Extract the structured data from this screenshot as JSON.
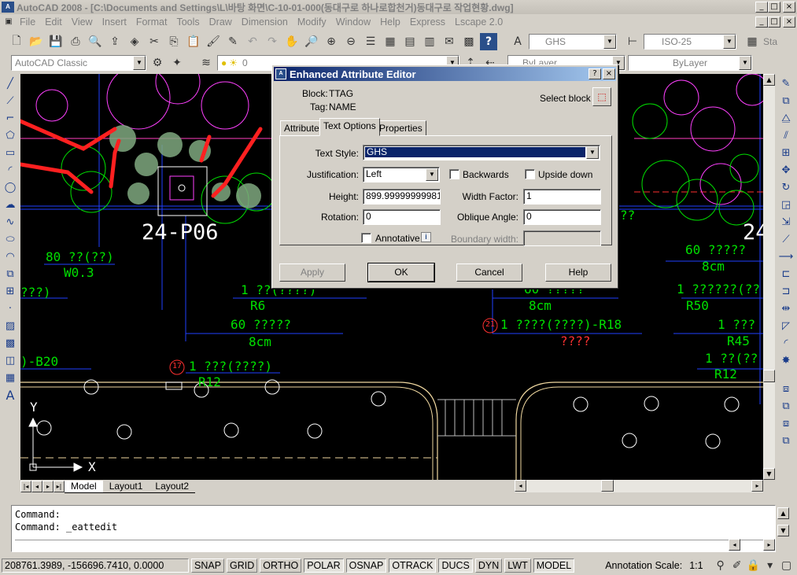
{
  "window": {
    "title": "AutoCAD 2008 - [C:\\Documents and Settings\\L\\바탕 화면\\C-10-01-000(동대구로 하나로합천거)동대구로 작업현황.dwg]",
    "icon": "autocad-app-icon",
    "min": "_",
    "restore": "□",
    "close": "×"
  },
  "menu": [
    "File",
    "Edit",
    "View",
    "Insert",
    "Format",
    "Tools",
    "Draw",
    "Dimension",
    "Modify",
    "Window",
    "Help",
    "Express",
    "Lscape 2.0"
  ],
  "toolbar": {
    "text_style_combo": "GHS",
    "dim_style_combo": "ISO-25",
    "workspace_combo": "AutoCAD Classic",
    "layer_combo": "0",
    "color_combo": "ByLayer",
    "linetype_combo": "ByLayer",
    "sta_label": "Sta"
  },
  "drawing": {
    "labels": [
      {
        "text": "24-P06",
        "color": "#ffffff"
      },
      {
        "text": "80 ??(??)",
        "color": "#00e000"
      },
      {
        "text": "W0.3",
        "color": "#00e000"
      },
      {
        "text": "???)",
        "color": "#00e000"
      },
      {
        "text": "1 ??(????)",
        "color": "#00e000"
      },
      {
        "text": "R6",
        "color": "#00e000"
      },
      {
        "text": "60 ?????",
        "color": "#00e000"
      },
      {
        "text": "8cm",
        "color": "#00e000"
      },
      {
        "text": ")-B20",
        "color": "#00e000"
      },
      {
        "text": "1 ???(????)",
        "color": "#00e000"
      },
      {
        "text": "R12",
        "color": "#00e000"
      },
      {
        "text": "1 ????(????)-R18",
        "color": "#00e000"
      },
      {
        "text": "????",
        "color": "#ff3030"
      },
      {
        "text": "60 ?????",
        "color": "#00e000"
      },
      {
        "text": "8cm",
        "color": "#00e000"
      },
      {
        "text": "1 ??????(??",
        "color": "#00e000"
      },
      {
        "text": "R50",
        "color": "#00e000"
      },
      {
        "text": "1 ???",
        "color": "#00e000"
      },
      {
        "text": "R45",
        "color": "#00e000"
      },
      {
        "text": "1 ??(??",
        "color": "#00e000"
      },
      {
        "text": "R12",
        "color": "#00e000"
      },
      {
        "text": "24",
        "color": "#ffffff"
      },
      {
        "text": "60 ?????",
        "color": "#00e000"
      },
      {
        "text": "8cm",
        "color": "#00e000"
      },
      {
        "text": "??",
        "color": "#00e000"
      }
    ],
    "markers": [
      "17",
      "21"
    ],
    "ucs_x": "X",
    "ucs_y": "Y"
  },
  "layout_tabs": [
    "Model",
    "Layout1",
    "Layout2"
  ],
  "command": {
    "lines": [
      "Command:",
      "Command:  _eattedit"
    ]
  },
  "status": {
    "coords": "208761.3989, -156696.7410, 0.0000",
    "toggles": [
      {
        "label": "SNAP",
        "on": false
      },
      {
        "label": "GRID",
        "on": false
      },
      {
        "label": "ORTHO",
        "on": false
      },
      {
        "label": "POLAR",
        "on": true
      },
      {
        "label": "OSNAP",
        "on": true
      },
      {
        "label": "OTRACK",
        "on": true
      },
      {
        "label": "DUCS",
        "on": true
      },
      {
        "label": "DYN",
        "on": false
      },
      {
        "label": "LWT",
        "on": false
      },
      {
        "label": "MODEL",
        "on": true
      }
    ],
    "annotation_scale_label": "Annotation Scale:",
    "annotation_scale_value": "1:1"
  },
  "dialog": {
    "title": "Enhanced Attribute Editor",
    "help_btn": "?",
    "close_btn": "×",
    "block_label": "Block:",
    "block_value": "TTAG",
    "tag_label": "Tag:",
    "tag_value": "NAME",
    "select_block_label": "Select block",
    "tabs": [
      "Attribute",
      "Text Options",
      "Properties"
    ],
    "active_tab": "Text Options",
    "text_style_label": "Text Style:",
    "text_style_value": "GHS",
    "justification_label": "Justification:",
    "justification_value": "Left",
    "backwards_label": "Backwards",
    "upside_down_label": "Upside down",
    "height_label": "Height:",
    "height_value": "899.999999999815",
    "width_factor_label": "Width Factor:",
    "width_factor_value": "1",
    "rotation_label": "Rotation:",
    "rotation_value": "0",
    "oblique_label": "Oblique Angle:",
    "oblique_value": "0",
    "annotative_label": "Annotative",
    "info_icon": "i",
    "boundary_label": "Boundary width:",
    "buttons": {
      "apply": "Apply",
      "ok": "OK",
      "cancel": "Cancel",
      "help": "Help"
    }
  }
}
